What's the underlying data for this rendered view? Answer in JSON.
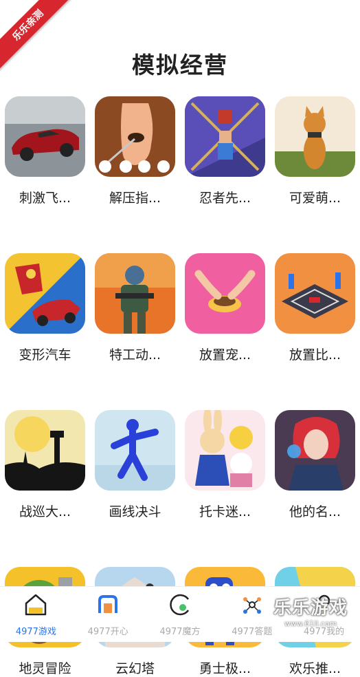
{
  "ribbon": "乐乐亲测",
  "page_title": "模拟经营",
  "games": [
    {
      "name": "刺激飞...",
      "icon": "car-icon"
    },
    {
      "name": "解压指...",
      "icon": "foot-icon"
    },
    {
      "name": "忍者先...",
      "icon": "ninja-icon"
    },
    {
      "name": "可爱萌...",
      "icon": "cat-icon"
    },
    {
      "name": "变形汽车",
      "icon": "robot-car-icon"
    },
    {
      "name": "特工动...",
      "icon": "agent-icon"
    },
    {
      "name": "放置宠...",
      "icon": "pet-bowl-icon"
    },
    {
      "name": "放置比...",
      "icon": "race-track-icon"
    },
    {
      "name": "战巡大...",
      "icon": "battle-icon"
    },
    {
      "name": "画线决斗",
      "icon": "blue-figure-icon"
    },
    {
      "name": "托卡迷...",
      "icon": "bunny-cat-icon"
    },
    {
      "name": "他的名...",
      "icon": "red-hair-icon"
    },
    {
      "name": "地灵冒险",
      "icon": "goblin-icon"
    },
    {
      "name": "云幻塔",
      "icon": "anime-girl-icon"
    },
    {
      "name": "勇士极...",
      "icon": "blue-monster-icon"
    },
    {
      "name": "欢乐推...",
      "icon": "ball-pusher-icon"
    }
  ],
  "tabs": [
    {
      "label": "4977游戏",
      "icon": "home-icon",
      "active": true
    },
    {
      "label": "4977开心",
      "icon": "happy-icon",
      "active": false
    },
    {
      "label": "4977魔方",
      "icon": "cube-icon",
      "active": false
    },
    {
      "label": "4977答题",
      "icon": "quiz-icon",
      "active": false
    },
    {
      "label": "4977我的",
      "icon": "user-icon",
      "active": false
    }
  ],
  "watermark": {
    "main": "乐乐游戏",
    "sub": "www.61ll.com"
  },
  "colors": {
    "accent": "#2a73e8",
    "ribbon": "#d8262e"
  }
}
